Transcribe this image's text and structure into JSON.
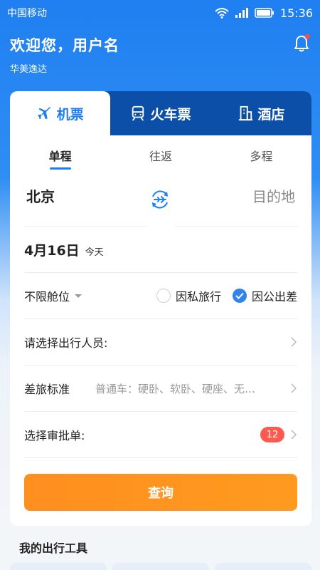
{
  "status_bar": {
    "carrier": "中国移动",
    "time": "15:36"
  },
  "header": {
    "greeting": "欢迎您，用户名",
    "company": "华美逸达"
  },
  "tabs": [
    {
      "label": "机票",
      "icon": "plane-icon",
      "active": true
    },
    {
      "label": "火车票",
      "icon": "train-icon",
      "active": false
    },
    {
      "label": "酒店",
      "icon": "hotel-icon",
      "active": false
    }
  ],
  "trip_types": [
    {
      "label": "单程",
      "active": true
    },
    {
      "label": "往返",
      "active": false
    },
    {
      "label": "多程",
      "active": false
    }
  ],
  "route": {
    "from": "北京",
    "to_placeholder": "目的地"
  },
  "date": {
    "main": "4月16日",
    "sub": "今天"
  },
  "cabin": {
    "label": "不限舱位",
    "options": [
      {
        "label": "因私旅行",
        "checked": false
      },
      {
        "label": "因公出差",
        "checked": true
      }
    ]
  },
  "travelers": {
    "label": "请选择出行人员:"
  },
  "policy": {
    "label": "差旅标准",
    "value": "普通车：硬卧、软卧、硬座、无…"
  },
  "approval": {
    "label": "选择审批单:",
    "badge": "12"
  },
  "search_button": "查询",
  "tools": {
    "title": "我的出行工具"
  },
  "colors": {
    "primary": "#1f7ff0",
    "tab_bar": "#0b4fa8",
    "search": "#ff9a1f",
    "badge": "#ff5a4e"
  }
}
